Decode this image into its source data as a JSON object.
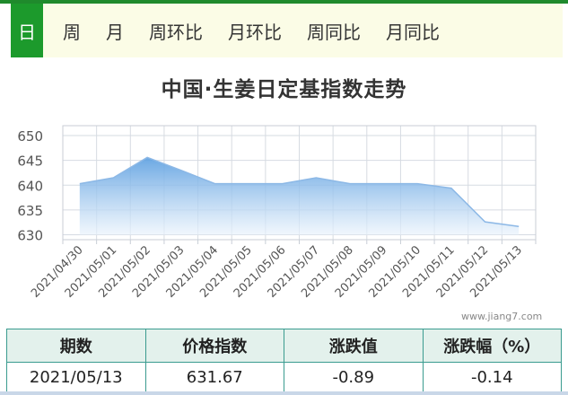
{
  "tabs": [
    {
      "label": "日",
      "active": true
    },
    {
      "label": "周",
      "active": false
    },
    {
      "label": "月",
      "active": false
    },
    {
      "label": "周环比",
      "active": false
    },
    {
      "label": "月环比",
      "active": false
    },
    {
      "label": "周同比",
      "active": false
    },
    {
      "label": "月同比",
      "active": false
    }
  ],
  "watermark": "www.jiang7.com",
  "chart_data": {
    "type": "area",
    "title": "中国·生姜日定基指数走势",
    "categories": [
      "2021/04/30",
      "2021/05/01",
      "2021/05/02",
      "2021/05/03",
      "2021/05/04",
      "2021/05/05",
      "2021/05/06",
      "2021/05/07",
      "2021/05/08",
      "2021/05/09",
      "2021/05/10",
      "2021/05/11",
      "2021/05/12",
      "2021/05/13"
    ],
    "series": [
      {
        "values": [
          640.3,
          641.5,
          645.6,
          643.0,
          640.3,
          640.3,
          640.3,
          641.5,
          640.3,
          640.3,
          640.3,
          639.4,
          632.6,
          631.67
        ]
      }
    ],
    "yticks": [
      630,
      635,
      640,
      645,
      650
    ],
    "ylim": [
      629,
      652
    ],
    "grid": true,
    "line_color": "#8cb8e6",
    "fill_top_color": "#5a9ee0",
    "fill_bottom_color": "#eaf3fc"
  },
  "summary": {
    "headers": [
      "期数",
      "价格指数",
      "涨跌值",
      "涨跌幅（%）"
    ],
    "row": [
      "2021/05/13",
      "631.67",
      "-0.89",
      "-0.14"
    ]
  }
}
